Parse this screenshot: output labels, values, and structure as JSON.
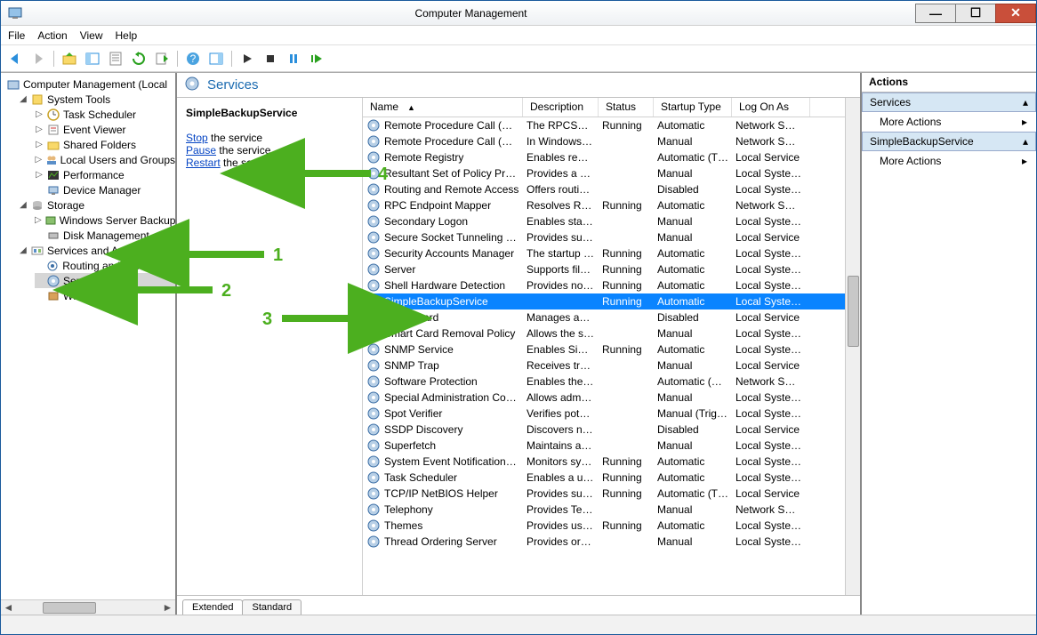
{
  "window": {
    "title": "Computer Management"
  },
  "menu": {
    "file": "File",
    "action": "Action",
    "view": "View",
    "help": "Help"
  },
  "tree": {
    "root": "Computer Management (Local",
    "systemTools": "System Tools",
    "taskScheduler": "Task Scheduler",
    "eventViewer": "Event Viewer",
    "sharedFolders": "Shared Folders",
    "localUsers": "Local Users and Groups",
    "performance": "Performance",
    "deviceManager": "Device Manager",
    "storage": "Storage",
    "wsb": "Windows Server Backup",
    "diskMgmt": "Disk Management",
    "svcApps": "Services and Applications",
    "rra": "Routing and Remote Ac",
    "services": "Services",
    "wmi": "WMI Control"
  },
  "servicesHeader": "Services",
  "detail": {
    "selectedName": "SimpleBackupService",
    "stopLink": "Stop",
    "stopSuffix": " the service",
    "pauseLink": "Pause",
    "pauseSuffix": " the service",
    "restartLink": "Restart",
    "restartSuffix": " the service"
  },
  "columns": {
    "name": "Name",
    "desc": "Description",
    "status": "Status",
    "startup": "Startup Type",
    "logon": "Log On As"
  },
  "rows": [
    {
      "n": "Remote Procedure Call (RPC)",
      "d": "The RPCSS …",
      "s": "Running",
      "t": "Automatic",
      "l": "Network S…"
    },
    {
      "n": "Remote Procedure Call (RP…",
      "d": "In Windows…",
      "s": "",
      "t": "Manual",
      "l": "Network S…"
    },
    {
      "n": "Remote Registry",
      "d": "Enables rem…",
      "s": "",
      "t": "Automatic (T…",
      "l": "Local Service"
    },
    {
      "n": "Resultant Set of Policy Provi…",
      "d": "Provides a n…",
      "s": "",
      "t": "Manual",
      "l": "Local Syste…"
    },
    {
      "n": "Routing and Remote Access",
      "d": "Offers routi…",
      "s": "",
      "t": "Disabled",
      "l": "Local Syste…"
    },
    {
      "n": "RPC Endpoint Mapper",
      "d": "Resolves RP…",
      "s": "Running",
      "t": "Automatic",
      "l": "Network S…"
    },
    {
      "n": "Secondary Logon",
      "d": "Enables star…",
      "s": "",
      "t": "Manual",
      "l": "Local Syste…"
    },
    {
      "n": "Secure Socket Tunneling Pr…",
      "d": "Provides su…",
      "s": "",
      "t": "Manual",
      "l": "Local Service"
    },
    {
      "n": "Security Accounts Manager",
      "d": "The startup …",
      "s": "Running",
      "t": "Automatic",
      "l": "Local Syste…"
    },
    {
      "n": "Server",
      "d": "Supports fil…",
      "s": "Running",
      "t": "Automatic",
      "l": "Local Syste…"
    },
    {
      "n": "Shell Hardware Detection",
      "d": "Provides no…",
      "s": "Running",
      "t": "Automatic",
      "l": "Local Syste…"
    },
    {
      "n": "SimpleBackupService",
      "d": "",
      "s": "Running",
      "t": "Automatic",
      "l": "Local Syste…",
      "sel": true
    },
    {
      "n": "Smart Card",
      "d": "Manages ac…",
      "s": "",
      "t": "Disabled",
      "l": "Local Service"
    },
    {
      "n": "Smart Card Removal Policy",
      "d": "Allows the s…",
      "s": "",
      "t": "Manual",
      "l": "Local Syste…"
    },
    {
      "n": "SNMP Service",
      "d": "Enables Sim…",
      "s": "Running",
      "t": "Automatic",
      "l": "Local Syste…"
    },
    {
      "n": "SNMP Trap",
      "d": "Receives tra…",
      "s": "",
      "t": "Manual",
      "l": "Local Service"
    },
    {
      "n": "Software Protection",
      "d": "Enables the …",
      "s": "",
      "t": "Automatic (D…",
      "l": "Network S…"
    },
    {
      "n": "Special Administration Con…",
      "d": "Allows adm…",
      "s": "",
      "t": "Manual",
      "l": "Local Syste…"
    },
    {
      "n": "Spot Verifier",
      "d": "Verifies pot…",
      "s": "",
      "t": "Manual (Trig…",
      "l": "Local Syste…"
    },
    {
      "n": "SSDP Discovery",
      "d": "Discovers n…",
      "s": "",
      "t": "Disabled",
      "l": "Local Service"
    },
    {
      "n": "Superfetch",
      "d": "Maintains a…",
      "s": "",
      "t": "Manual",
      "l": "Local Syste…"
    },
    {
      "n": "System Event Notification S…",
      "d": "Monitors sy…",
      "s": "Running",
      "t": "Automatic",
      "l": "Local Syste…"
    },
    {
      "n": "Task Scheduler",
      "d": "Enables a us…",
      "s": "Running",
      "t": "Automatic",
      "l": "Local Syste…"
    },
    {
      "n": "TCP/IP NetBIOS Helper",
      "d": "Provides su…",
      "s": "Running",
      "t": "Automatic (T…",
      "l": "Local Service"
    },
    {
      "n": "Telephony",
      "d": "Provides Tel…",
      "s": "",
      "t": "Manual",
      "l": "Network S…"
    },
    {
      "n": "Themes",
      "d": "Provides us…",
      "s": "Running",
      "t": "Automatic",
      "l": "Local Syste…"
    },
    {
      "n": "Thread Ordering Server",
      "d": "Provides or…",
      "s": "",
      "t": "Manual",
      "l": "Local Syste…"
    }
  ],
  "tabs": {
    "extended": "Extended",
    "standard": "Standard"
  },
  "actions": {
    "header": "Actions",
    "section1": "Services",
    "more1": "More Actions",
    "section2": "SimpleBackupService",
    "more2": "More Actions"
  },
  "annotations": {
    "a1": "1",
    "a2": "2",
    "a3": "3",
    "a4": "4"
  }
}
